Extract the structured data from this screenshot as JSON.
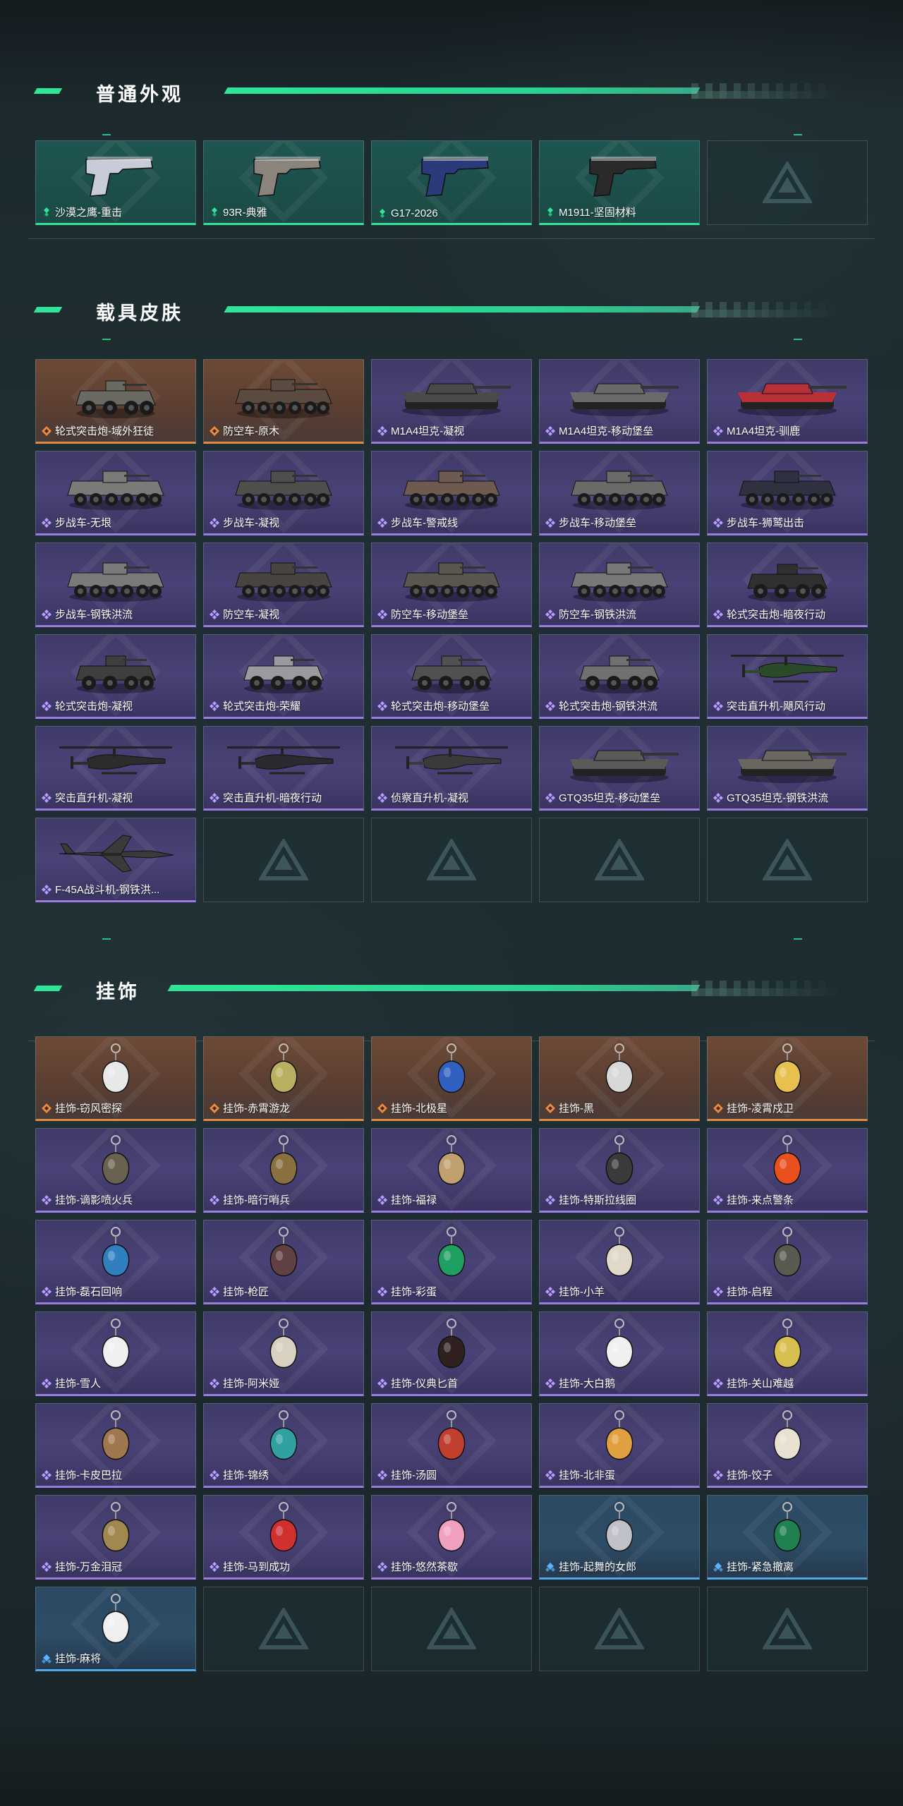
{
  "sections": {
    "normal": {
      "title": "普通外观",
      "items": [
        {
          "label": "沙漠之鹰-重击",
          "rarity": "green",
          "kind": "pistol",
          "color": "#c8ccd8"
        },
        {
          "label": "93R-典雅",
          "rarity": "green",
          "kind": "pistol",
          "color": "#8a847c"
        },
        {
          "label": "G17-2026",
          "rarity": "green",
          "kind": "pistol",
          "color": "#2a3a7a"
        },
        {
          "label": "M1911-坚固材料",
          "rarity": "green",
          "kind": "pistol",
          "color": "#2a2a2a"
        }
      ]
    },
    "vehicle": {
      "title": "载具皮肤",
      "items": [
        {
          "label": "轮式突击炮-域外狂徒",
          "rarity": "orange",
          "kind": "wheeled",
          "color": "#6a6a62"
        },
        {
          "label": "防空车-原木",
          "rarity": "orange",
          "kind": "apc",
          "color": "#5a4a40"
        },
        {
          "label": "M1A4坦克-凝视",
          "rarity": "purple",
          "kind": "tank",
          "color": "#4a4a48"
        },
        {
          "label": "M1A4坦克-移动堡垒",
          "rarity": "purple",
          "kind": "tank",
          "color": "#6a6a6a"
        },
        {
          "label": "M1A4坦克-驯鹿",
          "rarity": "purple",
          "kind": "tank",
          "color": "#b83038"
        },
        {
          "label": "步战车-无垠",
          "rarity": "purple",
          "kind": "apc",
          "color": "#7a7a78"
        },
        {
          "label": "步战车-凝视",
          "rarity": "purple",
          "kind": "apc",
          "color": "#4e4e4c"
        },
        {
          "label": "步战车-警戒线",
          "rarity": "purple",
          "kind": "apc",
          "color": "#6e5a50"
        },
        {
          "label": "步战车-移动堡垒",
          "rarity": "purple",
          "kind": "apc",
          "color": "#6a6a68"
        },
        {
          "label": "步战车-狮鹫出击",
          "rarity": "purple",
          "kind": "apc",
          "color": "#2f3040"
        },
        {
          "label": "步战车-钢铁洪流",
          "rarity": "purple",
          "kind": "apc",
          "color": "#7a7a7a"
        },
        {
          "label": "防空车-凝视",
          "rarity": "purple",
          "kind": "apc",
          "color": "#4a4440"
        },
        {
          "label": "防空车-移动堡垒",
          "rarity": "purple",
          "kind": "apc",
          "color": "#5a5650"
        },
        {
          "label": "防空车-钢铁洪流",
          "rarity": "purple",
          "kind": "apc",
          "color": "#787878"
        },
        {
          "label": "轮式突击炮-暗夜行动",
          "rarity": "purple",
          "kind": "wheeled",
          "color": "#303030"
        },
        {
          "label": "轮式突击炮-凝视",
          "rarity": "purple",
          "kind": "wheeled",
          "color": "#3e3e3c"
        },
        {
          "label": "轮式突击炮-荣耀",
          "rarity": "purple",
          "kind": "wheeled",
          "color": "#9a9aa0"
        },
        {
          "label": "轮式突击炮-移动堡垒",
          "rarity": "purple",
          "kind": "wheeled",
          "color": "#505050"
        },
        {
          "label": "轮式突击炮-钢铁洪流",
          "rarity": "purple",
          "kind": "wheeled",
          "color": "#707070"
        },
        {
          "label": "突击直升机-飓风行动",
          "rarity": "purple",
          "kind": "heli",
          "color": "#2a4a2a"
        },
        {
          "label": "突击直升机-凝视",
          "rarity": "purple",
          "kind": "heli",
          "color": "#2c2c2c"
        },
        {
          "label": "突击直升机-暗夜行动",
          "rarity": "purple",
          "kind": "heli",
          "color": "#2a2a30"
        },
        {
          "label": "侦察直升机-凝视",
          "rarity": "purple",
          "kind": "heli",
          "color": "#3a3a3a"
        },
        {
          "label": "GTQ35坦克-移动堡垒",
          "rarity": "purple",
          "kind": "tank",
          "color": "#5a5a58"
        },
        {
          "label": "GTQ35坦克-钢铁洪流",
          "rarity": "purple",
          "kind": "tank",
          "color": "#6a6660"
        },
        {
          "label": "F-45A战斗机-钢铁洪...",
          "rarity": "purple",
          "kind": "jet",
          "color": "#3a3a3a"
        }
      ]
    },
    "charm": {
      "title": "挂饰",
      "items": [
        {
          "label": "挂饰-窃风密探",
          "rarity": "orange",
          "color": "#e8e8e8"
        },
        {
          "label": "挂饰-赤霄游龙",
          "rarity": "orange",
          "color": "#b8b060"
        },
        {
          "label": "挂饰-北极星",
          "rarity": "orange",
          "color": "#3060c0"
        },
        {
          "label": "挂饰-黑",
          "rarity": "orange",
          "color": "#d8d8d8"
        },
        {
          "label": "挂饰-凌霄戍卫",
          "rarity": "orange",
          "color": "#e8c050"
        },
        {
          "label": "挂饰-谪影喷火兵",
          "rarity": "purple",
          "color": "#6a6250"
        },
        {
          "label": "挂饰-暗行哨兵",
          "rarity": "purple",
          "color": "#8a7040"
        },
        {
          "label": "挂饰-福禄",
          "rarity": "purple",
          "color": "#c0a070"
        },
        {
          "label": "挂饰-特斯拉线圈",
          "rarity": "purple",
          "color": "#3a3a3a"
        },
        {
          "label": "挂饰-来点警条",
          "rarity": "purple",
          "color": "#e85020"
        },
        {
          "label": "挂饰-磊石回响",
          "rarity": "purple",
          "color": "#3080c0"
        },
        {
          "label": "挂饰-枪匠",
          "rarity": "purple",
          "color": "#604040"
        },
        {
          "label": "挂饰-彩蛋",
          "rarity": "purple",
          "color": "#20a060"
        },
        {
          "label": "挂饰-小羊",
          "rarity": "purple",
          "color": "#e0d8c8"
        },
        {
          "label": "挂饰-启程",
          "rarity": "purple",
          "color": "#5a5a50"
        },
        {
          "label": "挂饰-雪人",
          "rarity": "purple",
          "color": "#f0f0f0"
        },
        {
          "label": "挂饰-阿米娅",
          "rarity": "purple",
          "color": "#d8d0c0"
        },
        {
          "label": "挂饰-仪典匕首",
          "rarity": "purple",
          "color": "#302020"
        },
        {
          "label": "挂饰-大白鹅",
          "rarity": "purple",
          "color": "#f0f0f0"
        },
        {
          "label": "挂饰-关山难越",
          "rarity": "purple",
          "color": "#d8c050"
        },
        {
          "label": "挂饰-卡皮巴拉",
          "rarity": "purple",
          "color": "#a07850"
        },
        {
          "label": "挂饰-锦绣",
          "rarity": "purple",
          "color": "#30a0a0"
        },
        {
          "label": "挂饰-汤圆",
          "rarity": "purple",
          "color": "#c04030"
        },
        {
          "label": "挂饰-北非蛋",
          "rarity": "purple",
          "color": "#e0a040"
        },
        {
          "label": "挂饰-饺子",
          "rarity": "purple",
          "color": "#e8e0d0"
        },
        {
          "label": "挂饰-万金泪冠",
          "rarity": "purple",
          "color": "#a08850"
        },
        {
          "label": "挂饰-马到成功",
          "rarity": "purple",
          "color": "#d03030"
        },
        {
          "label": "挂饰-悠然茶歇",
          "rarity": "purple",
          "color": "#f0a0c0"
        },
        {
          "label": "挂饰-起舞的女郎",
          "rarity": "blue",
          "color": "#c0c0c8"
        },
        {
          "label": "挂饰-紧急撤离",
          "rarity": "blue",
          "color": "#208050"
        },
        {
          "label": "挂饰-麻将",
          "rarity": "blue",
          "color": "#f0f0f0"
        }
      ]
    }
  },
  "colors": {
    "accent": "#2ee59a",
    "orange": "#e08a4a",
    "purple": "#9d7ce0",
    "blue": "#4fa8e8"
  },
  "icons": {
    "empty_logo": "delta-logo-icon",
    "rarity": "diamond-rarity-icon"
  }
}
